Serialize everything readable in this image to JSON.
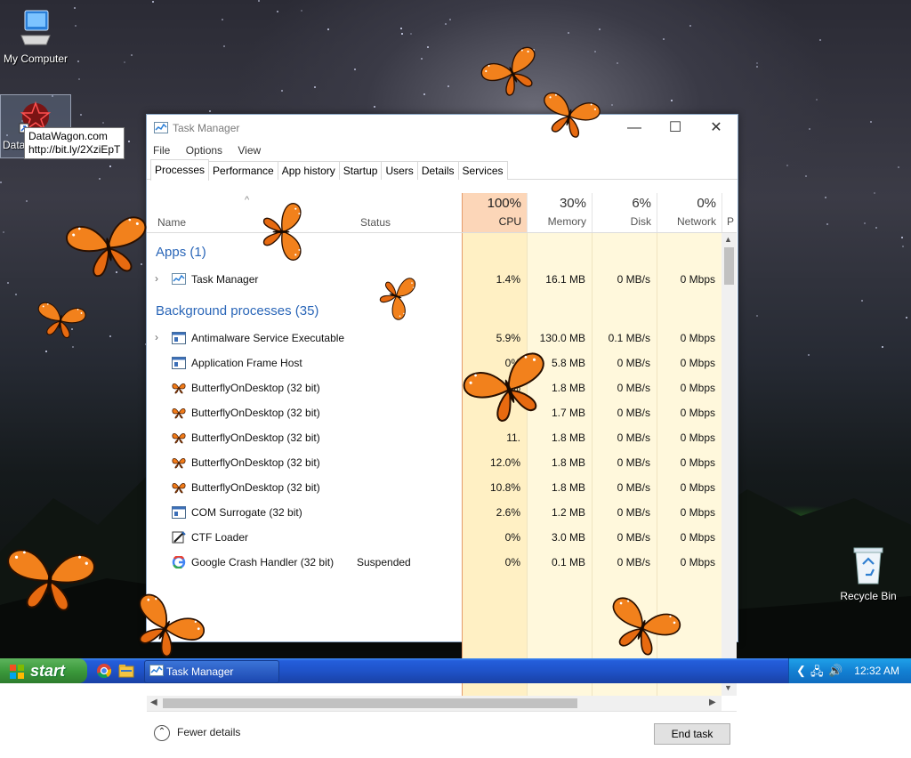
{
  "desktop": {
    "icons": [
      {
        "label": "My Computer"
      },
      {
        "label": "Data"
      },
      {
        "label": "Recycle Bin"
      }
    ],
    "tooltip": {
      "line1": "DataWagon.com",
      "line2": "http://bit.ly/2XziEpT"
    }
  },
  "window": {
    "title": "Task Manager",
    "menu": [
      "File",
      "Options",
      "View"
    ],
    "tabs": [
      "Processes",
      "Performance",
      "App history",
      "Startup",
      "Users",
      "Details",
      "Services"
    ],
    "active_tab": "Processes",
    "columns": {
      "name": "Name",
      "status": "Status",
      "cpu": {
        "pct": "100%",
        "label": "CPU"
      },
      "memory": {
        "pct": "30%",
        "label": "Memory"
      },
      "disk": {
        "pct": "6%",
        "label": "Disk"
      },
      "network": {
        "pct": "0%",
        "label": "Network"
      },
      "power": "P"
    },
    "groups": {
      "apps": "Apps (1)",
      "background": "Background processes (35)"
    },
    "apps": [
      {
        "name": "Task Manager",
        "status": "",
        "cpu": "1.4%",
        "memory": "16.1 MB",
        "disk": "0 MB/s",
        "network": "0 Mbps",
        "expandable": true,
        "icon": "task-manager-icon"
      }
    ],
    "background": [
      {
        "name": "Antimalware Service Executable",
        "status": "",
        "cpu": "5.9%",
        "memory": "130.0 MB",
        "disk": "0.1 MB/s",
        "network": "0 Mbps",
        "expandable": true,
        "icon": "service-icon"
      },
      {
        "name": "Application Frame Host",
        "status": "",
        "cpu": "0%",
        "memory": "5.8 MB",
        "disk": "0 MB/s",
        "network": "0 Mbps",
        "expandable": false,
        "icon": "service-icon"
      },
      {
        "name": "ButterflyOnDesktop (32 bit)",
        "status": "",
        "cpu": "9.3%",
        "memory": "1.8 MB",
        "disk": "0 MB/s",
        "network": "0 Mbps",
        "expandable": false,
        "icon": "butterfly-icon"
      },
      {
        "name": "ButterflyOnDesktop (32 bit)",
        "status": "",
        "cpu": "",
        "memory": "1.7 MB",
        "disk": "0 MB/s",
        "network": "0 Mbps",
        "expandable": false,
        "icon": "butterfly-icon"
      },
      {
        "name": "ButterflyOnDesktop (32 bit)",
        "status": "",
        "cpu": "11.",
        "memory": "1.8 MB",
        "disk": "0 MB/s",
        "network": "0 Mbps",
        "expandable": false,
        "icon": "butterfly-icon"
      },
      {
        "name": "ButterflyOnDesktop (32 bit)",
        "status": "",
        "cpu": "12.0%",
        "memory": "1.8 MB",
        "disk": "0 MB/s",
        "network": "0 Mbps",
        "expandable": false,
        "icon": "butterfly-icon"
      },
      {
        "name": "ButterflyOnDesktop (32 bit)",
        "status": "",
        "cpu": "10.8%",
        "memory": "1.8 MB",
        "disk": "0 MB/s",
        "network": "0 Mbps",
        "expandable": false,
        "icon": "butterfly-icon"
      },
      {
        "name": "COM Surrogate (32 bit)",
        "status": "",
        "cpu": "2.6%",
        "memory": "1.2 MB",
        "disk": "0 MB/s",
        "network": "0 Mbps",
        "expandable": false,
        "icon": "service-icon"
      },
      {
        "name": "CTF Loader",
        "status": "",
        "cpu": "0%",
        "memory": "3.0 MB",
        "disk": "0 MB/s",
        "network": "0 Mbps",
        "expandable": false,
        "icon": "ctf-icon"
      },
      {
        "name": "Google Crash Handler (32 bit)",
        "status": "Suspended",
        "cpu": "0%",
        "memory": "0.1 MB",
        "disk": "0 MB/s",
        "network": "0 Mbps",
        "expandable": false,
        "icon": "google-icon"
      }
    ],
    "footer": {
      "fewer_details": "Fewer details",
      "end_task": "End task"
    }
  },
  "taskbar": {
    "start": "start",
    "task_label": "Task Manager",
    "clock": "12:32 AM"
  },
  "colors": {
    "cpu_header": "#fcd6b8",
    "cpu_cell": "#fff0c4",
    "other_cell": "#fff8dc",
    "group_text": "#2a66b8",
    "taskbar": "#245edb",
    "start_button": "#3c9a3c"
  }
}
